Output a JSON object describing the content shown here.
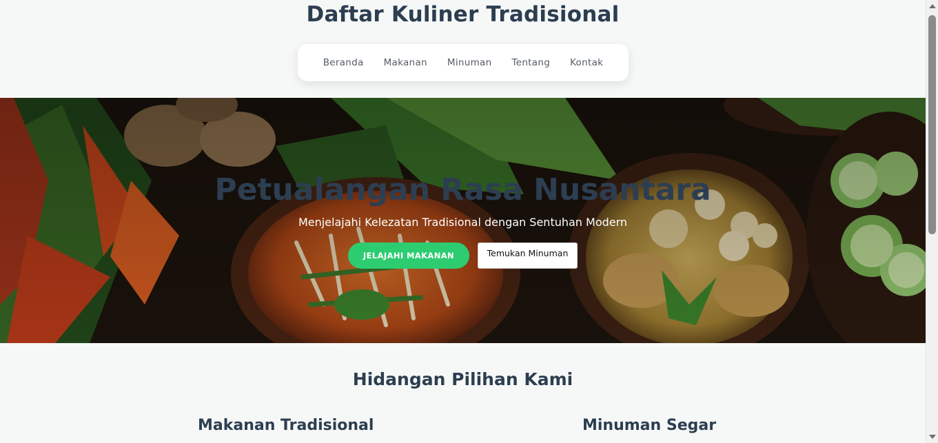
{
  "header": {
    "title": "Daftar Kuliner Tradisional"
  },
  "nav": {
    "items": [
      {
        "label": "Beranda"
      },
      {
        "label": "Makanan"
      },
      {
        "label": "Minuman"
      },
      {
        "label": "Tentang"
      },
      {
        "label": "Kontak"
      }
    ]
  },
  "hero": {
    "title": "Petualangan Rasa Nusantara",
    "subtitle": "Menjelajahi Kelezatan Tradisional dengan Sentuhan Modern",
    "primary_button": "JELAJAHI MAKANAN",
    "secondary_button": "Temukan Minuman"
  },
  "featured": {
    "title": "Hidangan Pilihan Kami",
    "columns": [
      {
        "title": "Makanan Tradisional"
      },
      {
        "title": "Minuman Segar"
      }
    ]
  },
  "colors": {
    "accent_green": "#2ecc71",
    "heading": "#2c3e50",
    "page_bg": "#f6f8f8"
  }
}
